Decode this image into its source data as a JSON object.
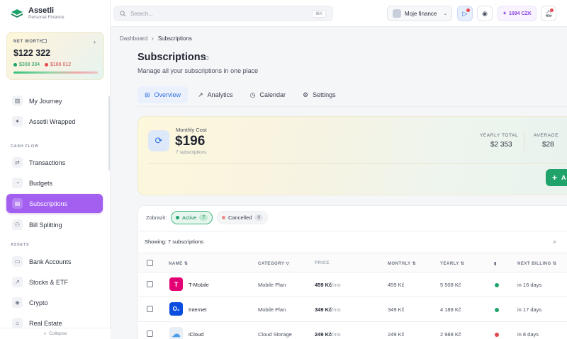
{
  "app": {
    "name": "Assetli",
    "tagline": "Personal Finance"
  },
  "net_worth": {
    "label": "NET WORTH",
    "value": "$122 322",
    "assets": "$308 334",
    "liabilities": "$186 012",
    "arrow": "›"
  },
  "sidebar": {
    "items": [
      {
        "label": "My Journey",
        "icon": "map-icon",
        "glyph": "▥"
      },
      {
        "label": "Assetli Wrapped",
        "icon": "gift-icon",
        "glyph": "✦"
      },
      {
        "label": "Transactions",
        "icon": "arrows-icon",
        "glyph": "⇄"
      },
      {
        "label": "Budgets",
        "icon": "pie-icon",
        "glyph": "◔"
      },
      {
        "label": "Subscriptions",
        "icon": "subscription-icon",
        "glyph": "▤",
        "active": true
      },
      {
        "label": "Bill Splitting",
        "icon": "users-icon",
        "glyph": "⚇"
      },
      {
        "label": "Bank Accounts",
        "icon": "bank-icon",
        "glyph": "▭"
      },
      {
        "label": "Stocks & ETF",
        "icon": "trend-icon",
        "glyph": "↗"
      },
      {
        "label": "Crypto",
        "icon": "crypto-icon",
        "glyph": "◈"
      },
      {
        "label": "Real Estate",
        "icon": "house-icon",
        "glyph": "⌂"
      }
    ],
    "sections": {
      "cash_flow": "CASH FLOW",
      "assets": "ASSETS"
    },
    "collapse": "Collapse"
  },
  "topbar": {
    "search_placeholder": "Search...",
    "shortcut": "⌘K",
    "workspace": "Moje finance",
    "coins": "1094 CZK"
  },
  "breadcrumb": {
    "root": "Dashboard",
    "current": "Subscriptions"
  },
  "page": {
    "title": "Subscriptions",
    "subtitle": "Manage all your subscriptions in one place"
  },
  "tabs": [
    {
      "label": "Overview",
      "glyph": "⊞"
    },
    {
      "label": "Analytics",
      "glyph": "↗"
    },
    {
      "label": "Calendar",
      "glyph": "◷"
    },
    {
      "label": "Settings",
      "glyph": "⚙"
    }
  ],
  "summary": {
    "monthly_label": "Monthly Cost",
    "monthly_value": "$196",
    "monthly_sub": "7 subscriptions",
    "yearly_label": "YEARLY TOTAL",
    "yearly_value": "$2 353",
    "average_label": "AVERAGE",
    "average_value": "$28",
    "add_label": "A"
  },
  "filters": {
    "label": "Zobrazit:",
    "active": "Active",
    "active_count": "7",
    "cancelled": "Cancelled",
    "cancelled_count": "0"
  },
  "table": {
    "showing": "Showing: 7 subscriptions",
    "headers": {
      "name": "NAME",
      "category": "CATEGORY",
      "price": "PRICE",
      "monthly": "MONTHLY",
      "yearly": "YEARLY",
      "next_billing": "NEXT BILLING"
    },
    "rows": [
      {
        "name": "T-Mobile",
        "category": "Mobile Plan",
        "price": "459 Kč",
        "unit": "/mo",
        "monthly": "459 Kč",
        "yearly": "5 508 Kč",
        "next": "in 16 days",
        "logo": "T",
        "logo_color": "#e20074",
        "status_color": "#1fa36a"
      },
      {
        "name": "Internet",
        "category": "Mobile Plan",
        "price": "349 Kč",
        "unit": "/mo",
        "monthly": "349 Kč",
        "yearly": "4 188 Kč",
        "next": "in 17 days",
        "logo": "O₂",
        "logo_color": "#0a4ee0",
        "status_color": "#1fa36a"
      },
      {
        "name": "iCloud",
        "category": "Cloud Storage",
        "price": "249 Kč",
        "unit": "/mo",
        "monthly": "249 Kč",
        "yearly": "2 988 Kč",
        "next": "in 8 days",
        "logo": "☁",
        "logo_color": "#e8eef6",
        "status_color": "#e5484d"
      }
    ]
  },
  "colors": {
    "accent": "#a25ff0",
    "brand_green": "#1fa36a",
    "link_blue": "#2f6fe0"
  }
}
